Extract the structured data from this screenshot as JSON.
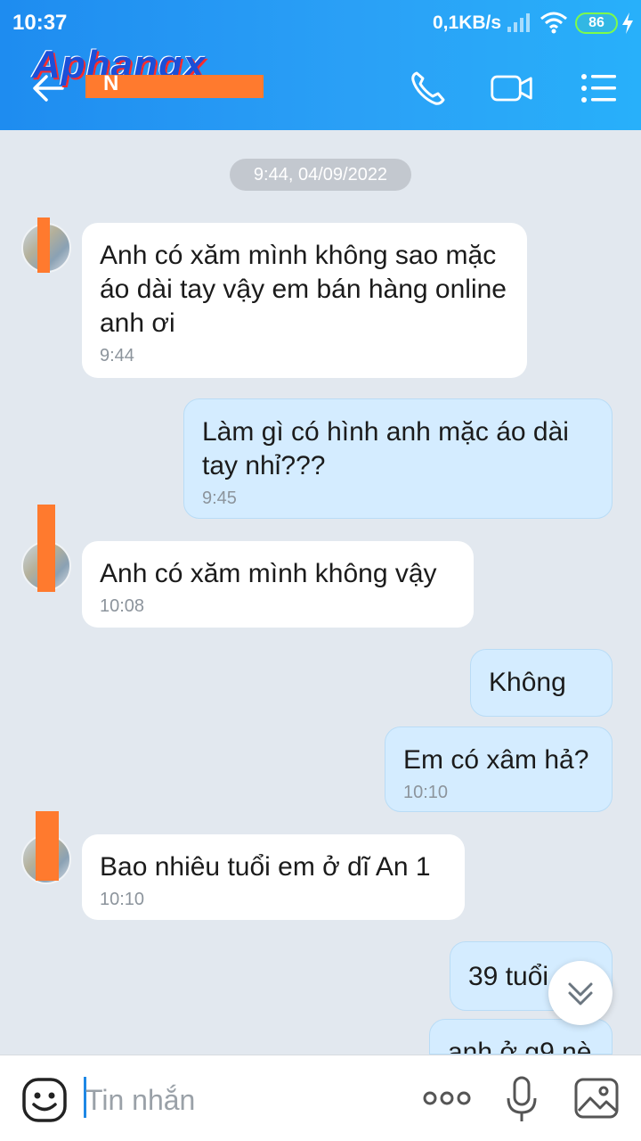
{
  "status_bar": {
    "time": "10:37",
    "network_speed": "0,1KB/s",
    "battery": "86"
  },
  "header": {
    "watermark": "Aphangx",
    "contact_name_fragment": "N",
    "accent_color": "#2196f3"
  },
  "chat": {
    "timestamp_chip": "9:44, 04/09/2022",
    "messages": [
      {
        "side": "in",
        "text": "Anh có xăm mình không sao mặc áo dài tay vậy em bán hàng online anh ơi",
        "time": "9:44"
      },
      {
        "side": "out",
        "text": "Làm gì có hình anh mặc áo dài tay nhỉ???",
        "time": "9:45"
      },
      {
        "side": "in",
        "text": "Anh có xăm mình không vậy",
        "time": "10:08"
      },
      {
        "side": "out",
        "text": "Không",
        "time": ""
      },
      {
        "side": "out",
        "text": "Em có xâm hả?",
        "time": "10:10"
      },
      {
        "side": "in",
        "text": "Bao nhiêu tuổi em ở dĩ An 1",
        "time": "10:10"
      },
      {
        "side": "out",
        "text": "39 tuổi",
        "time": ""
      },
      {
        "side": "out",
        "text": "anh ở g9 nè",
        "time": ""
      }
    ]
  },
  "composer": {
    "placeholder": "Tin nhắn"
  },
  "icons": [
    "back-arrow-icon",
    "phone-icon",
    "video-call-icon",
    "menu-list-icon",
    "chevron-double-down-icon",
    "emoji-icon",
    "more-dots-icon",
    "microphone-icon",
    "image-icon"
  ]
}
